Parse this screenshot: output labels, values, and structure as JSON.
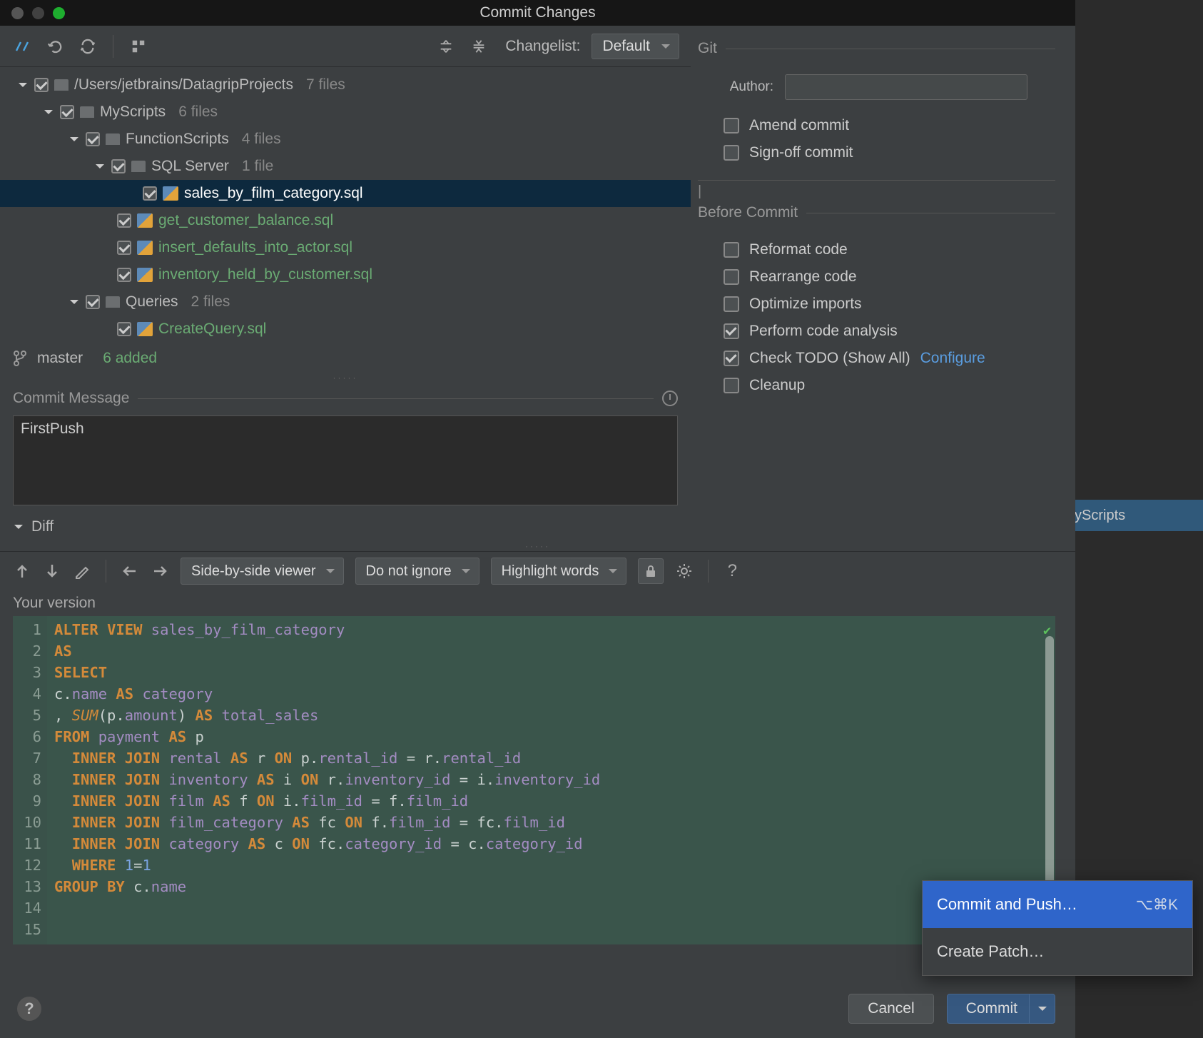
{
  "window": {
    "title": "Commit Changes"
  },
  "bg": {
    "tab": "yScripts"
  },
  "toolbar": {
    "changelist_label": "Changelist:",
    "changelist_value": "Default"
  },
  "tree": {
    "root": {
      "path": "/Users/jetbrains/DatagripProjects",
      "count": "7 files"
    },
    "myscripts": {
      "name": "MyScripts",
      "count": "6 files"
    },
    "fnscripts": {
      "name": "FunctionScripts",
      "count": "4 files"
    },
    "sqlserver": {
      "name": "SQL Server",
      "count": "1 file"
    },
    "file_sales": "sales_by_film_category.sql",
    "file_getcust": "get_customer_balance.sql",
    "file_insert": "insert_defaults_into_actor.sql",
    "file_inv": "inventory_held_by_customer.sql",
    "queries": {
      "name": "Queries",
      "count": "2 files"
    },
    "file_createq": "CreateQuery.sql"
  },
  "branch": {
    "name": "master",
    "status": "6 added"
  },
  "commit_msg": {
    "label": "Commit Message",
    "value": "FirstPush"
  },
  "diff": {
    "label": "Diff",
    "viewer": "Side-by-side viewer",
    "ignore": "Do not ignore",
    "highlight": "Highlight words",
    "version_label": "Your version"
  },
  "code": {
    "lines": [
      "ALTER VIEW sales_by_film_category",
      "AS",
      "SELECT",
      "c.name AS category",
      ", SUM(p.amount) AS total_sales",
      "FROM payment AS p",
      "  INNER JOIN rental AS r ON p.rental_id = r.rental_id",
      "  INNER JOIN inventory AS i ON r.inventory_id = i.inventory_id",
      "  INNER JOIN film AS f ON i.film_id = f.film_id",
      "  INNER JOIN film_category AS fc ON f.film_id = fc.film_id",
      "  INNER JOIN category AS c ON fc.category_id = c.category_id",
      "  WHERE 1=1",
      "GROUP BY c.name",
      "",
      ""
    ]
  },
  "right": {
    "git_label": "Git",
    "author_label": "Author:",
    "author_value": "",
    "amend": "Amend commit",
    "signoff": "Sign-off commit",
    "before_label": "Before Commit",
    "reformat": "Reformat code",
    "rearrange": "Rearrange code",
    "optimize": "Optimize imports",
    "analysis": "Perform code analysis",
    "todo": "Check TODO (Show All)",
    "configure": "Configure",
    "cleanup": "Cleanup"
  },
  "footer": {
    "cancel": "Cancel",
    "commit": "Commit"
  },
  "popup": {
    "commit_push": "Commit and Push…",
    "commit_push_sc": "⌥⌘K",
    "patch": "Create Patch…"
  }
}
